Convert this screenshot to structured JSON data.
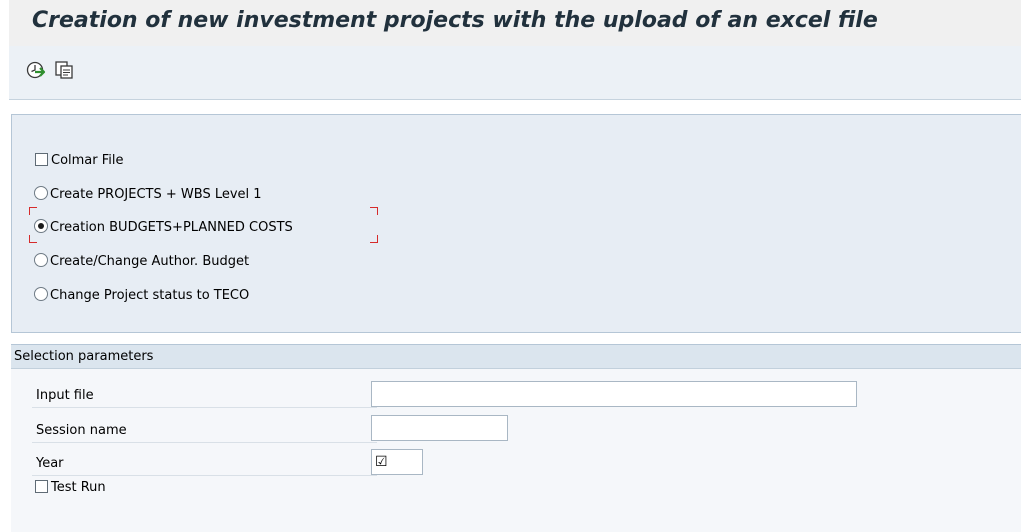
{
  "header": {
    "title": "Creation of new investment projects with the upload of an excel file"
  },
  "toolbar": {
    "buttons": [
      {
        "icon": "execute-clock-icon"
      },
      {
        "icon": "copy-variant-icon"
      }
    ]
  },
  "options": {
    "colmar_file": {
      "label": "Colmar File",
      "checked": false
    },
    "radios": [
      {
        "label": "Create PROJECTS + WBS Level 1",
        "selected": false
      },
      {
        "label": "Creation BUDGETS+PLANNED COSTS",
        "selected": true
      },
      {
        "label": "Create/Change Author. Budget",
        "selected": false
      },
      {
        "label": "Change Project status to TECO",
        "selected": false
      }
    ]
  },
  "selection": {
    "title": "Selection parameters",
    "input_file": {
      "label": "Input file",
      "value": ""
    },
    "session_name": {
      "label": "Session name",
      "value": ""
    },
    "year": {
      "label": "Year",
      "value": ""
    },
    "test_run": {
      "label": "Test Run",
      "checked": false
    }
  },
  "colors": {
    "title": "#21313d",
    "panel_bg": "#e7edf4",
    "focus": "#d62b2b"
  }
}
